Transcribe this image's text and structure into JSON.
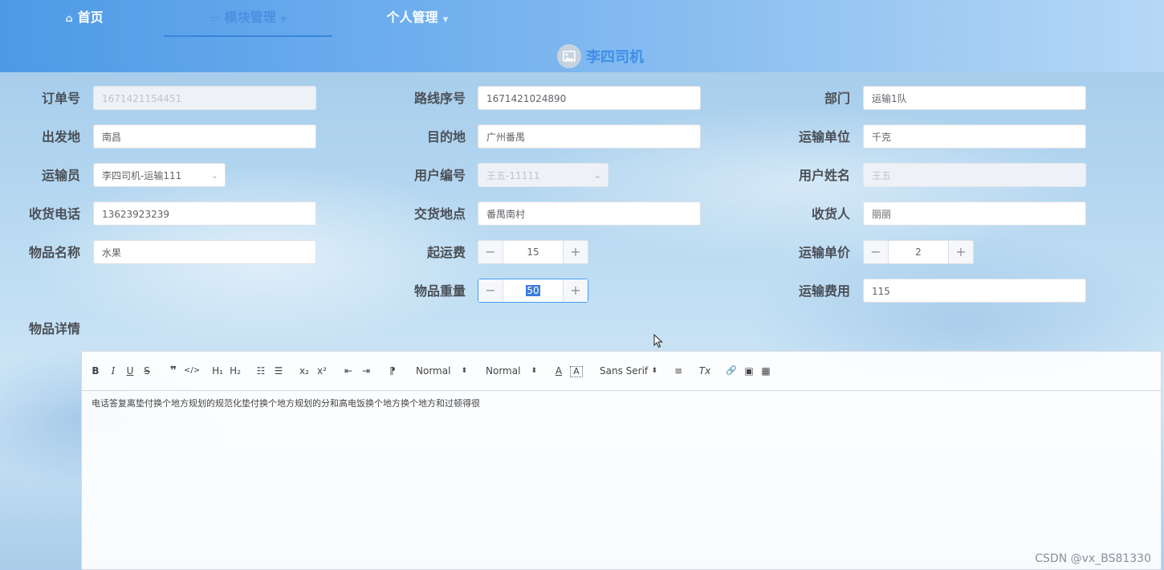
{
  "nav": {
    "items": [
      {
        "label": "首页",
        "icon": "home-icon",
        "dropdown": false,
        "active": false
      },
      {
        "label": "模块管理",
        "icon": "monitor-icon",
        "dropdown": true,
        "active": true
      },
      {
        "label": "个人管理",
        "icon": "",
        "dropdown": true,
        "active": false
      }
    ]
  },
  "user": {
    "name": "李四司机",
    "avatar_icon": "picture-icon"
  },
  "form": {
    "order_no": {
      "label": "订单号",
      "value": "1671421154451",
      "disabled": true
    },
    "route_no": {
      "label": "路线序号",
      "value": "1671421024890"
    },
    "department": {
      "label": "部门",
      "value": "运输1队"
    },
    "origin": {
      "label": "出发地",
      "value": "南昌"
    },
    "destination": {
      "label": "目的地",
      "value": "广州番禺"
    },
    "transport_unit": {
      "label": "运输单位",
      "value": "千克"
    },
    "transporter": {
      "label": "运输员",
      "value": "李四司机-运输111"
    },
    "user_no": {
      "label": "用户编号",
      "value": "王五-11111",
      "disabled": true
    },
    "user_name": {
      "label": "用户姓名",
      "value": "王五",
      "disabled": true
    },
    "receiver_phone": {
      "label": "收货电话",
      "value": "13623923239"
    },
    "delivery_place": {
      "label": "交货地点",
      "value": "番禺南村"
    },
    "receiver": {
      "label": "收货人",
      "value": "丽丽"
    },
    "goods_name": {
      "label": "物品名称",
      "value": "水果"
    },
    "base_fee": {
      "label": "起运费",
      "value": "15"
    },
    "unit_price": {
      "label": "运输单价",
      "value": "2"
    },
    "weight": {
      "label": "物品重量",
      "value": "50"
    },
    "transport_fee": {
      "label": "运输费用",
      "value": "115"
    },
    "details": {
      "label": "物品详情"
    }
  },
  "editor": {
    "toolbar": {
      "bold": "B",
      "italic": "I",
      "underline": "U",
      "strike": "S",
      "quote": "❞",
      "code": "</>",
      "h1": "H₁",
      "h2": "H₂",
      "ordered_list": "☷",
      "bullet_list": "☰",
      "subscript": "x₂",
      "superscript": "x²",
      "outdent": "⇤",
      "indent": "⇥",
      "direction": "⁋",
      "size_picker": "Normal",
      "header_picker": "Normal",
      "color": "A",
      "background": "A",
      "font_picker": "Sans Serif",
      "align": "≡",
      "clean": "Tx",
      "link": "🔗",
      "image": "▣",
      "video": "▦"
    },
    "content": "电话答复离垫付换个地方规划的规范化垫付换个地方规划的分和高电饭换个地方换个地方和过顿得很"
  },
  "watermark": "CSDN @vx_BS81330"
}
